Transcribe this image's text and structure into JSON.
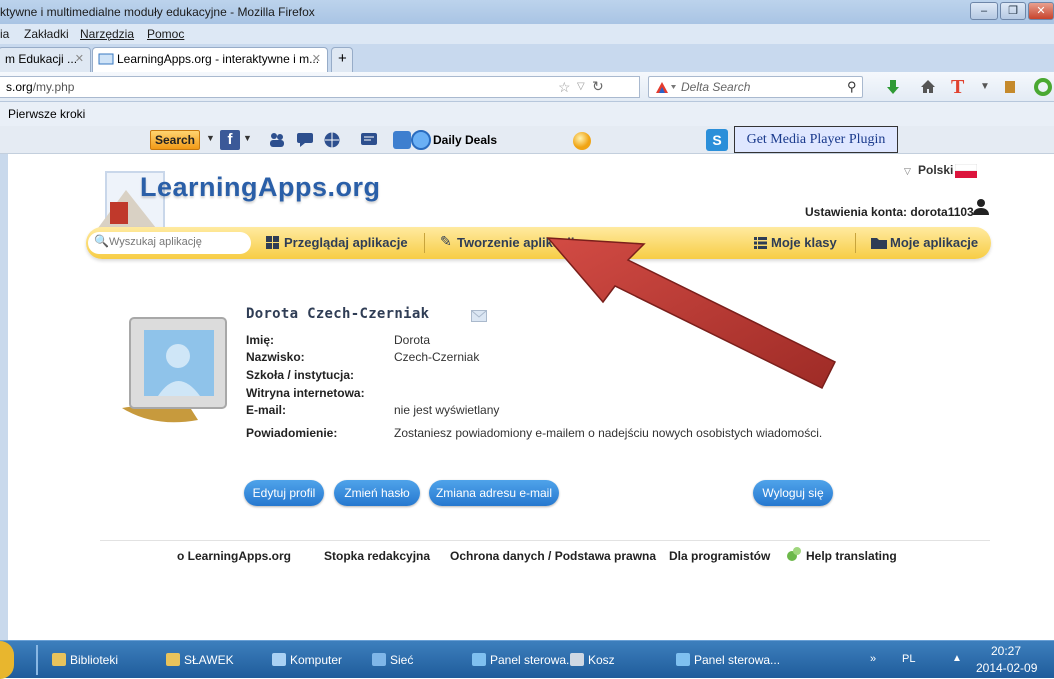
{
  "window": {
    "title": "ktywne i multimedialne moduły edukacyjne - Mozilla Firefox",
    "controls": [
      "–",
      "❐",
      "✕"
    ]
  },
  "menu": [
    "ia",
    "Zakładki",
    "Narzędzia",
    "Pomoc"
  ],
  "tabs": [
    {
      "label": "m Edukacji ..."
    },
    {
      "label": "LearningApps.org - interaktywne i m..."
    }
  ],
  "new_tab": "+",
  "address": {
    "domain_tail": "s.org",
    "path": "/my.php"
  },
  "search": {
    "placeholder": "Delta Search"
  },
  "bookmarks": [
    "Pierwsze kroki"
  ],
  "toolbar": {
    "search_label": "Search",
    "daily_deals": "Daily Deals",
    "media_plugin": "Get Media Player Plugin"
  },
  "site": {
    "logo": "LearningApps.org",
    "language": "Polski",
    "account": "Ustawienia konta: dorota1103",
    "search_placeholder": "Wyszukaj aplikację",
    "nav": {
      "browse": "Przeglądaj aplikacje",
      "create": "Tworzenie aplikacji",
      "classes": "Moje klasy",
      "my_apps": "Moje aplikacje"
    }
  },
  "profile": {
    "name": "Dorota Czech-Czerniak",
    "fields": [
      {
        "label": "Imię:",
        "value": "Dorota"
      },
      {
        "label": "Nazwisko:",
        "value": "Czech-Czerniak"
      },
      {
        "label": "Szkoła / instytucja:",
        "value": ""
      },
      {
        "label": "Witryna internetowa:",
        "value": ""
      },
      {
        "label": "E-mail:",
        "value": "nie jest wyświetlany"
      },
      {
        "label": "Powiadomienie:",
        "value": "Zostaniesz powiadomiony e-mailem o nadejściu nowych osobistych wiadomości."
      }
    ]
  },
  "actions": {
    "edit_profile": "Edytuj profil",
    "change_password": "Zmień hasło",
    "change_email": "Zmiana adresu e-mail",
    "logout": "Wyloguj się"
  },
  "footer": {
    "about": "o LearningApps.org",
    "imprint": "Stopka redakcyjna",
    "privacy": "Ochrona danych / Podstawa prawna",
    "developers": "Dla programistów",
    "translate": "Help translating"
  },
  "taskbar": {
    "items": [
      "Biblioteki",
      "SŁAWEK",
      "Komputer",
      "Sieć",
      "Panel sterowa...",
      "Kosz",
      "Panel sterowa..."
    ],
    "lang": "PL",
    "time": "20:27",
    "date": "2014-02-09"
  },
  "colors": {
    "nav_yellow": "#f7cd45",
    "button_blue": "#2678cf",
    "arrow_red": "#b83a33",
    "logo_blue": "#2a5fa8"
  }
}
